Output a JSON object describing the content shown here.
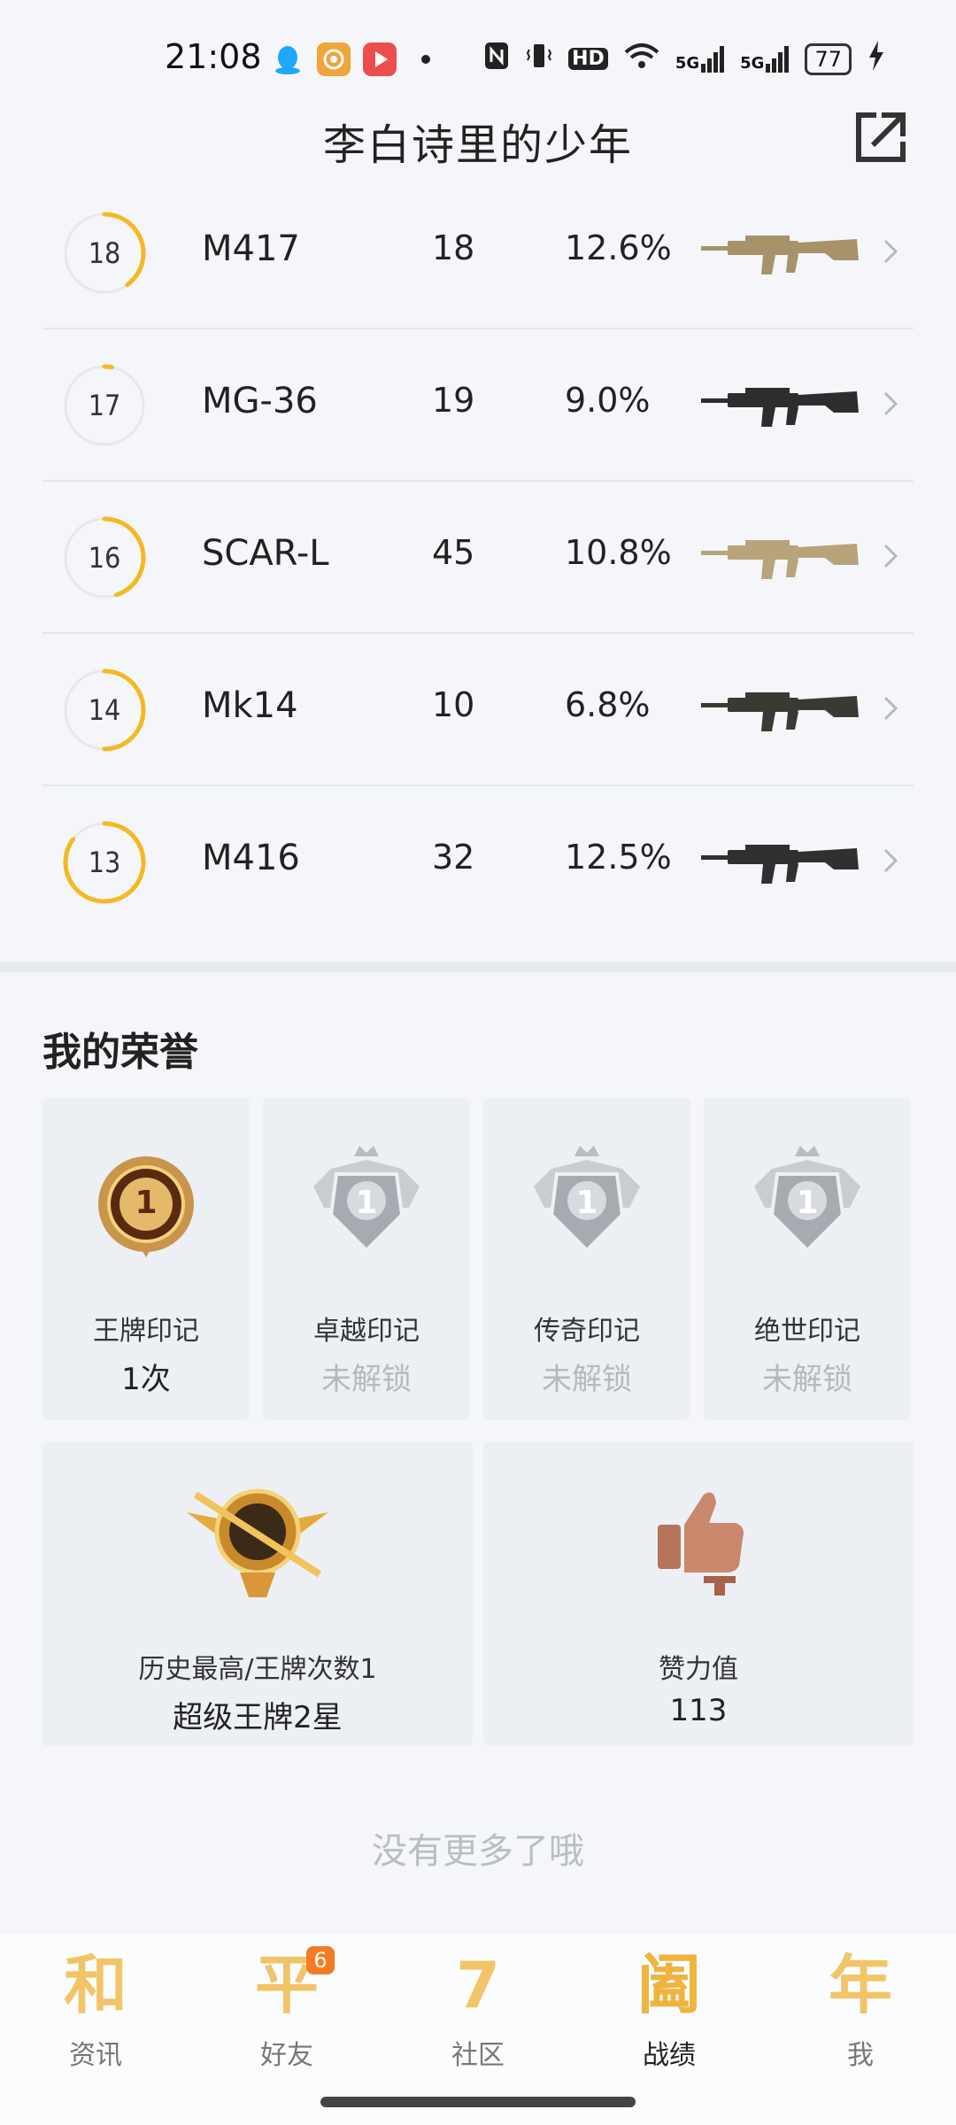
{
  "status_bar": {
    "time": "21:08",
    "icons": [
      "qq-icon",
      "podcast-icon",
      "video-icon",
      "dot-icon",
      "nfc-icon",
      "vibrate-icon",
      "hd-icon",
      "wifi-icon",
      "signal-5g-icon",
      "signal-5g-icon",
      "battery-icon",
      "charging-icon"
    ],
    "battery_level": "77",
    "hd_label": "HD",
    "signal_label": "5G"
  },
  "header": {
    "title": "李白诗里的少年",
    "share_icon": "share-external-icon"
  },
  "weapons": [
    {
      "level": "18",
      "progress": 0.4,
      "name": "M417",
      "count": "18",
      "rate": "12.6%",
      "color": "#a8926a"
    },
    {
      "level": "17",
      "progress": 0.03,
      "name": "MG-36",
      "count": "19",
      "rate": "9.0%",
      "color": "#2d2d2d"
    },
    {
      "level": "16",
      "progress": 0.45,
      "name": "SCAR-L",
      "count": "45",
      "rate": "10.8%",
      "color": "#b9a37a"
    },
    {
      "level": "14",
      "progress": 0.5,
      "name": "Mk14",
      "count": "10",
      "rate": "6.8%",
      "color": "#3a3a35"
    },
    {
      "level": "13",
      "progress": 0.85,
      "name": "M416",
      "count": "32",
      "rate": "12.5%",
      "color": "#2f3030"
    }
  ],
  "honors": {
    "title": "我的荣誉",
    "cards": [
      {
        "label": "王牌印记",
        "value": "1次",
        "locked": false,
        "icon": "ace-mark-badge-icon",
        "badge_number": "1"
      },
      {
        "label": "卓越印记",
        "value": "未解锁",
        "locked": true,
        "icon": "excellence-mark-badge-icon",
        "badge_number": "1"
      },
      {
        "label": "传奇印记",
        "value": "未解锁",
        "locked": true,
        "icon": "legend-mark-badge-icon",
        "badge_number": "1"
      },
      {
        "label": "绝世印记",
        "value": "未解锁",
        "locked": true,
        "icon": "peerless-mark-badge-icon",
        "badge_number": "1"
      }
    ],
    "big_cards": [
      {
        "label": "历史最高/王牌次数1",
        "value": "超级王牌2星",
        "icon": "super-ace-rank-emblem-icon"
      },
      {
        "label": "赞力值",
        "value": "113",
        "icon": "thumbs-up-trophy-icon"
      }
    ]
  },
  "no_more_text": "没有更多了哦",
  "tabs": [
    {
      "label": "资讯",
      "glyph": "和",
      "icon": "news-tab-icon",
      "active": false,
      "badge": ""
    },
    {
      "label": "好友",
      "glyph": "平",
      "icon": "friends-tab-icon",
      "active": false,
      "badge": "6"
    },
    {
      "label": "社区",
      "glyph": "7",
      "icon": "community-tab-icon",
      "active": false,
      "badge": ""
    },
    {
      "label": "战绩",
      "glyph": "阖",
      "icon": "records-tab-icon",
      "active": true,
      "badge": ""
    },
    {
      "label": "我",
      "glyph": "年",
      "icon": "profile-tab-icon",
      "active": false,
      "badge": ""
    }
  ]
}
